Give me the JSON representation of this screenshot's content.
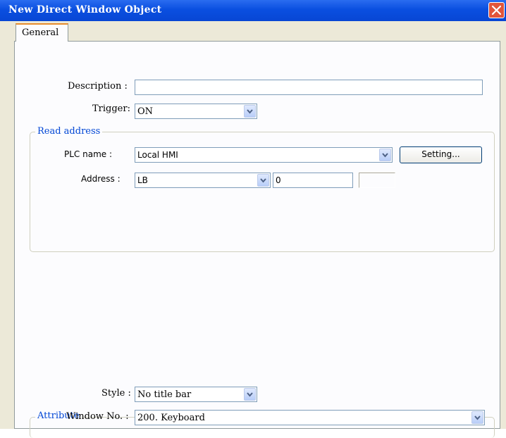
{
  "window": {
    "title": "New  Direct Window Object"
  },
  "tabs": [
    {
      "label": "General"
    }
  ],
  "general": {
    "description_label": "Description :",
    "description_value": "",
    "trigger_label": "Trigger:",
    "trigger_value": "ON"
  },
  "read_address": {
    "legend": "Read address",
    "plc_name_label": "PLC name :",
    "plc_name_value": "Local HMI",
    "setting_button": "Setting...",
    "address_label": "Address :",
    "address_type": "LB",
    "address_value": "0",
    "address_extra": ""
  },
  "attribute": {
    "legend": "Attribute",
    "style_label": "Style :",
    "style_value": "No title bar",
    "window_no_label": "Window No. :",
    "window_no_value": "200. Keyboard"
  },
  "colors": {
    "titlebar": "#0a4fe0",
    "group_legend": "#0046d5",
    "close_button": "#e2553a"
  },
  "icons": [
    "close-icon",
    "chevron-down-icon"
  ]
}
